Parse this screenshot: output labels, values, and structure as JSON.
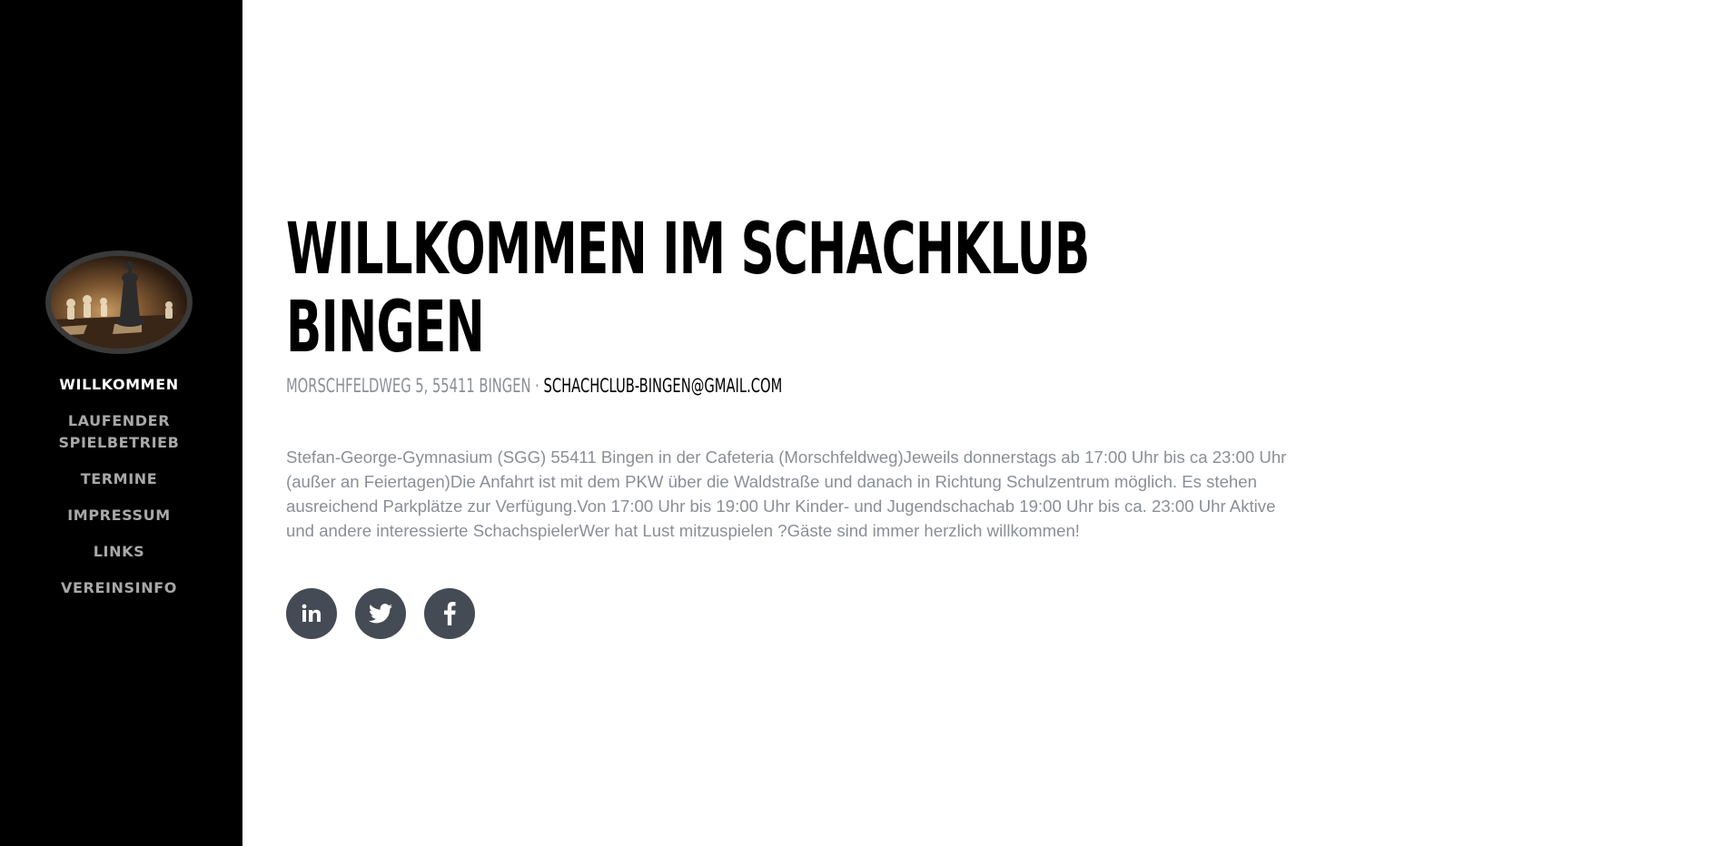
{
  "sidebar": {
    "logo_alt": "Chess pieces logo",
    "nav": [
      {
        "label": "WILLKOMMEN",
        "active": true
      },
      {
        "label": "LAUFENDER SPIELBETRIEB",
        "active": false
      },
      {
        "label": "TERMINE",
        "active": false
      },
      {
        "label": "IMPRESSUM",
        "active": false
      },
      {
        "label": "LINKS",
        "active": false
      },
      {
        "label": "VEREINSINFO",
        "active": false
      }
    ]
  },
  "main": {
    "title": "WILLKOMMEN IM SCHACHKLUB BINGEN",
    "address": "MORSCHFELDWEG 5, 55411 BINGEN",
    "separator": " · ",
    "email": "SCHACHCLUB-BINGEN@GMAIL.COM",
    "description": "Stefan-George-Gymnasium (SGG) 55411 Bingen in der Cafeteria (Morschfeldweg)Jeweils donnerstags ab 17:00 Uhr bis ca 23:00 Uhr (außer an Feiertagen)Die Anfahrt ist mit dem PKW über die Waldstraße und danach in Richtung Schulzentrum möglich. Es stehen ausreichend Parkplätze zur Verfügung.Von 17:00 Uhr bis 19:00 Uhr Kinder- und Jugendschachab 19:00 Uhr bis ca. 23:00 Uhr Aktive und andere interessierte SchachspielerWer hat Lust mitzuspielen ?Gäste sind immer herzlich willkommen!"
  },
  "social": [
    {
      "icon": "linkedin-icon"
    },
    {
      "icon": "twitter-icon"
    },
    {
      "icon": "facebook-icon"
    }
  ],
  "colors": {
    "sidebar_bg": "#000000",
    "nav_active": "#ffffff",
    "nav_inactive": "#a8a8a8",
    "text_muted": "#8a8f96",
    "social_bg": "#454b54"
  }
}
